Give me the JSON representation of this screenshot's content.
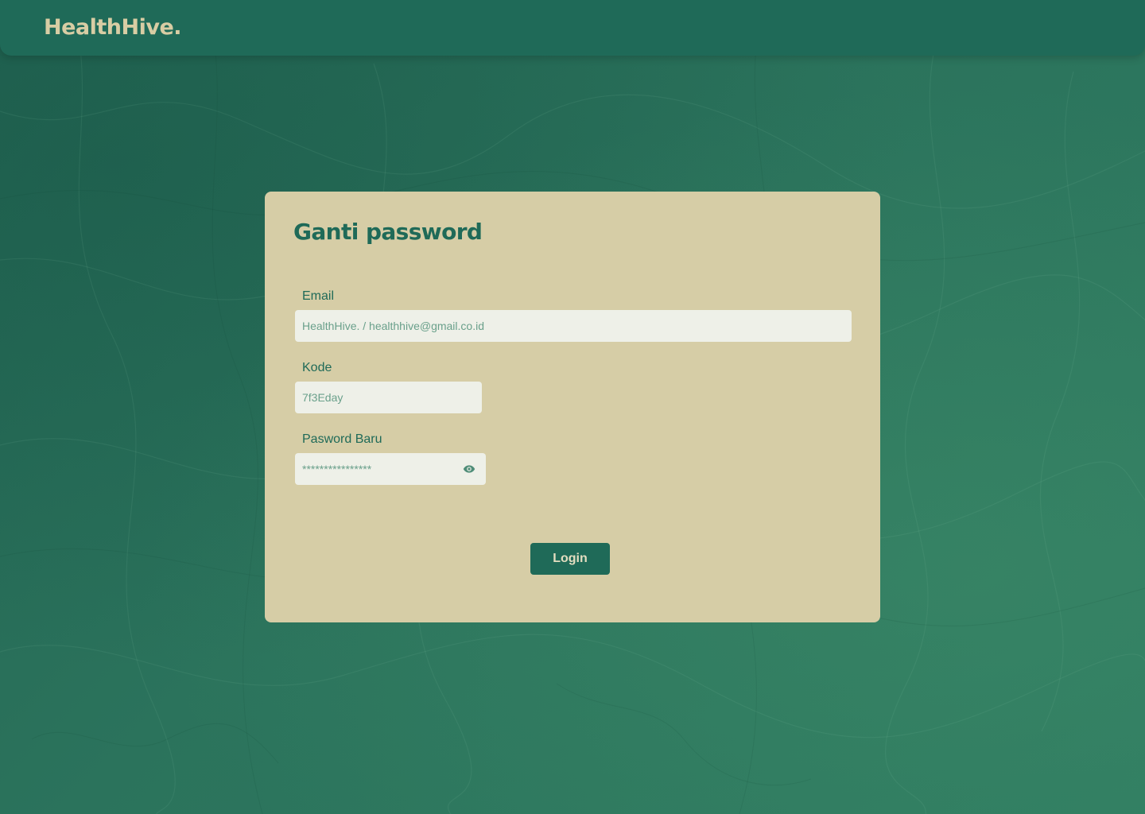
{
  "header": {
    "logo_text": "HealthHive."
  },
  "form": {
    "title": "Ganti password",
    "email_label": "Email",
    "email_placeholder": "HealthHive. / healthhive@gmail.co.id",
    "code_label": "Kode",
    "code_placeholder": "7f3Eday",
    "new_password_label": "Pasword Baru",
    "new_password_placeholder": "****************",
    "submit_label": "Login"
  },
  "icons": {
    "password_toggle": "eye-icon"
  },
  "colors": {
    "primary": "#1f6a58",
    "card_background": "#d6cda6",
    "input_background": "#eef0e8",
    "logo": "#d8cda4",
    "page_background": "#276d58"
  }
}
